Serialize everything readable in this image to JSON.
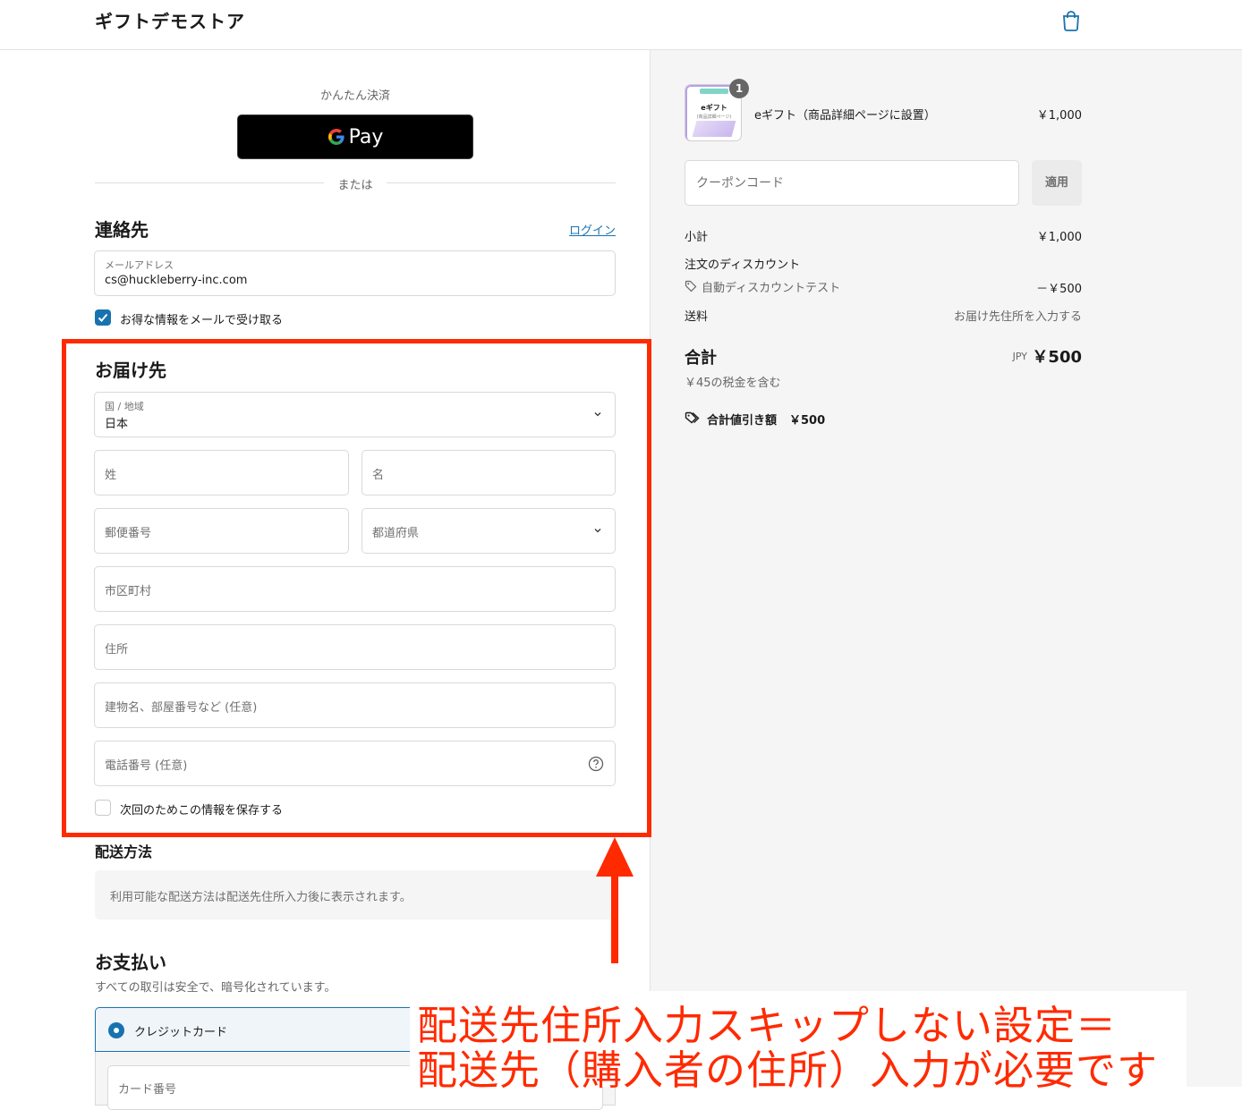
{
  "header": {
    "store_name": "ギフトデモストア"
  },
  "express": {
    "title": "かんたん決済",
    "gpay_label": "Pay",
    "or": "または"
  },
  "contact": {
    "heading": "連絡先",
    "login": "ログイン",
    "email_label": "メールアドレス",
    "email_value": "cs@huckleberry-inc.com",
    "newsletter_label": "お得な情報をメールで受け取る",
    "newsletter_checked": true
  },
  "delivery": {
    "heading": "お届け先",
    "country_label": "国 / 地域",
    "country_value": "日本",
    "last_name": "姓",
    "first_name": "名",
    "postal_code": "郵便番号",
    "prefecture": "都道府県",
    "city": "市区町村",
    "address": "住所",
    "building": "建物名、部屋番号など (任意)",
    "phone": "電話番号 (任意)",
    "save_info_label": "次回のためこの情報を保存する",
    "save_info_checked": false
  },
  "shipping_method": {
    "heading": "配送方法",
    "note": "利用可能な配送方法は配送先住所入力後に表示されます。"
  },
  "payment": {
    "heading": "お支払い",
    "subtitle": "すべての取引は安全で、暗号化されています。",
    "option_label": "クレジットカード",
    "card_number_placeholder": "カード番号"
  },
  "annotation": {
    "line1": "配送先住所入力スキップしない設定＝",
    "line2": "配送先（購入者の住所）入力が必要です",
    "color": "#ff2a00"
  },
  "summary": {
    "item": {
      "thumb_banner": "2000円商品",
      "thumb_title": "eギフト",
      "thumb_sub": "(商品詳細ページ)",
      "quantity": "1",
      "name": "eギフト（商品詳細ページに設置）",
      "price": "￥1,000"
    },
    "coupon_placeholder": "クーポンコード",
    "apply_label": "適用",
    "subtotal_label": "小計",
    "subtotal_value": "￥1,000",
    "order_discount_label": "注文のディスカウント",
    "discount_name": "自動ディスカウントテスト",
    "discount_value": "－￥500",
    "shipping_label": "送料",
    "shipping_value": "お届け先住所を入力する",
    "total_label": "合計",
    "currency": "JPY",
    "total_value": "￥500",
    "tax_note": "￥45の税金を含む",
    "savings_label": "合計値引き額",
    "savings_value": "￥500"
  },
  "colors": {
    "accent": "#1773b0",
    "annotation_red": "#ff2a00"
  },
  "icons": [
    "shopping-bag-icon",
    "google-g-icon",
    "chevron-down-icon",
    "check-icon",
    "tag-icon",
    "help-circle-icon"
  ]
}
